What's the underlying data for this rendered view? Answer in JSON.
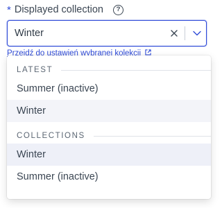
{
  "field": {
    "required_mark": "*",
    "label": "Displayed collection",
    "help_icon": "?"
  },
  "select": {
    "value": "Winter",
    "clear_icon": "close-icon",
    "dropdown_icon": "chevron-down-icon"
  },
  "hint_link": {
    "text": "Przejdź do ustawień wybranej kolekcji"
  },
  "menu": {
    "groups": [
      {
        "header": "LATEST",
        "options": [
          {
            "label": "Summer (inactive)",
            "state": "normal"
          },
          {
            "label": "Winter",
            "state": "selected"
          }
        ]
      },
      {
        "header": "COLLECTIONS",
        "options": [
          {
            "label": "Winter",
            "state": "focused"
          },
          {
            "label": "Summer (inactive)",
            "state": "normal"
          }
        ]
      }
    ]
  },
  "colors": {
    "accent": "#2f4bd8",
    "text": "#3b4653",
    "selected_bg": "#f3f4f9"
  }
}
